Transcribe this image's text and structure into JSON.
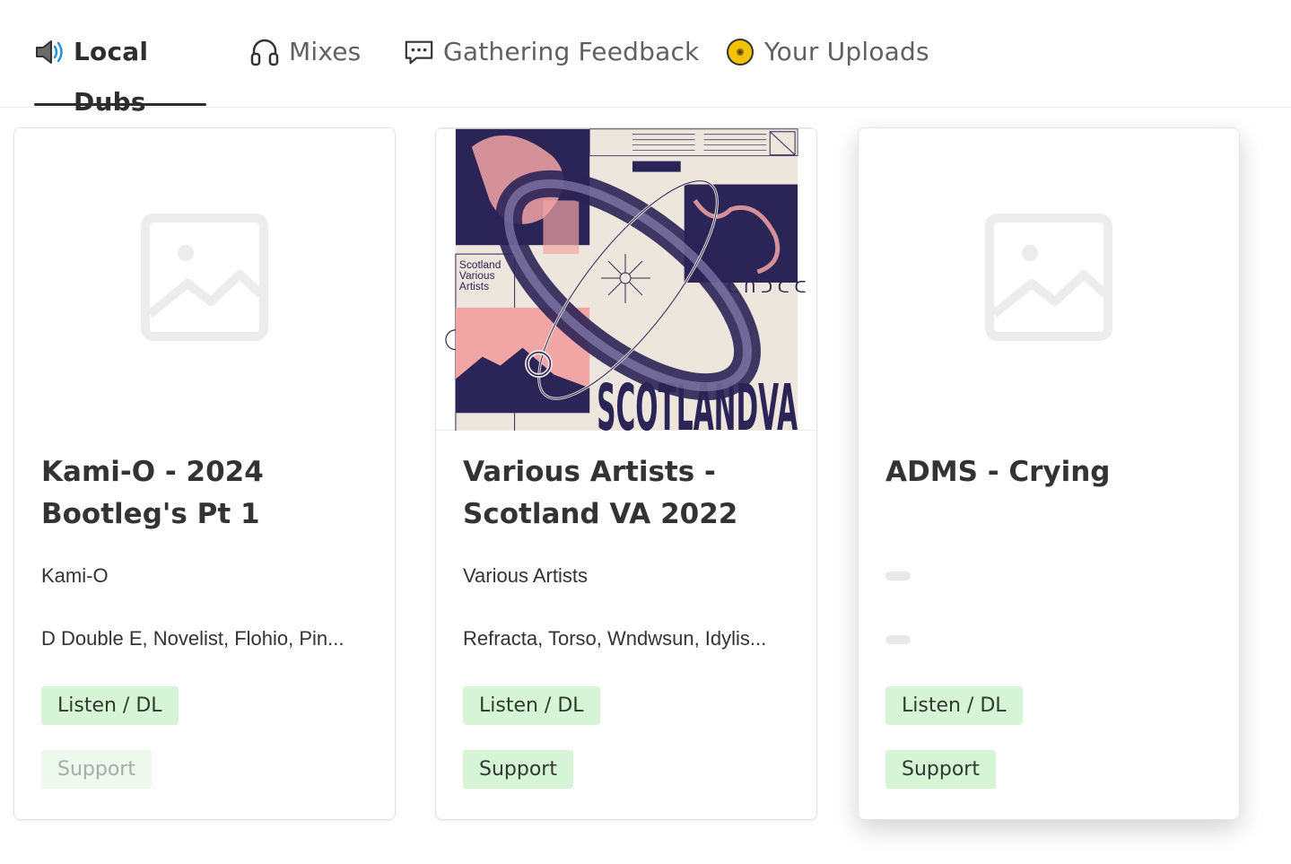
{
  "tabs": [
    {
      "label": "Local Dubs",
      "icon": "speaker-icon",
      "active": true
    },
    {
      "label": "Mixes",
      "icon": "headphones-icon",
      "active": false
    },
    {
      "label": "Gathering Feedback",
      "icon": "chat-bubble-icon",
      "active": false
    },
    {
      "label": "Your Uploads",
      "icon": "vinyl-icon",
      "active": false
    }
  ],
  "cards": [
    {
      "title": "Kami-O - 2024 Bootleg's Pt 1",
      "artist": "Kami-O",
      "featuring": "D Double E, Novelist, Flohio, Pin...",
      "listen_label": "Listen / DL",
      "support_label": "Support",
      "support_enabled": false,
      "cover": "placeholder-image-icon"
    },
    {
      "title": "Various Artists - Scotland VA 2022",
      "artist": "Various Artists",
      "featuring": "Refracta, Torso, Wndwsun, Idylis...",
      "listen_label": "Listen / DL",
      "support_label": "Support",
      "support_enabled": true,
      "cover": "album-artwork",
      "cover_text": {
        "heading": "Scotland\nVarious\nArtists",
        "big": "SCOTLAND VA",
        "label": "MIDNIGHT BASS"
      }
    },
    {
      "title": "ADMS - Crying",
      "artist": "",
      "featuring": "",
      "listen_label": "Listen / DL",
      "support_label": "Support",
      "support_enabled": true,
      "cover": "placeholder-image-icon"
    }
  ],
  "colors": {
    "button_bg": "#d6f5d6",
    "button_disabled_bg": "#ecf9ec",
    "active_tab": "#2d2d2d",
    "art_navy": "#2b2456",
    "art_pink": "#f2a5a5",
    "art_cream": "#ece6dd"
  }
}
